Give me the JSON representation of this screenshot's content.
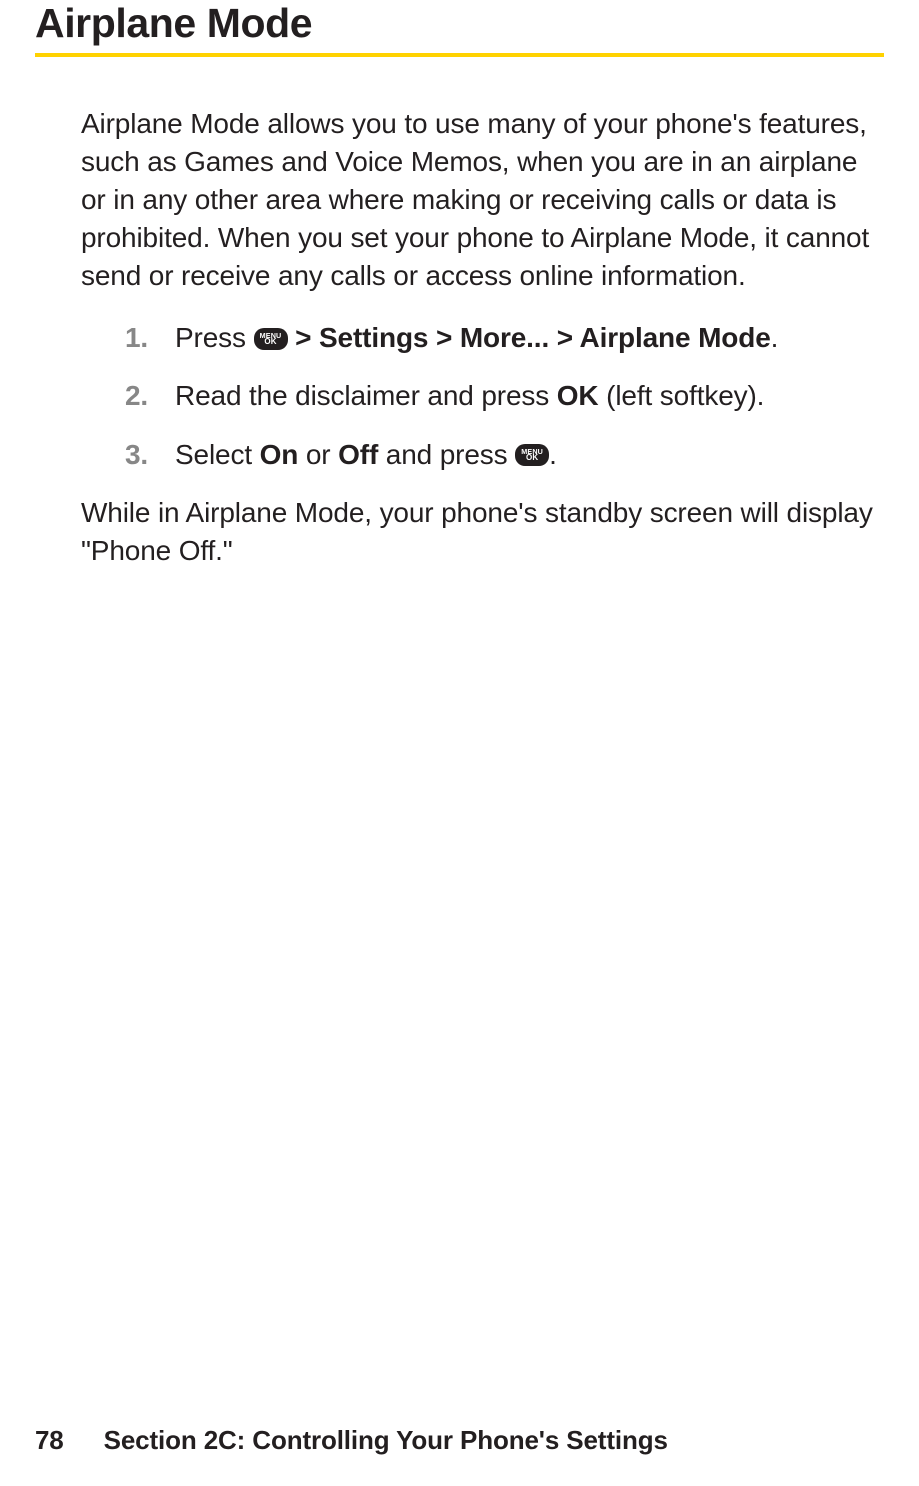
{
  "heading": "Airplane Mode",
  "intro": "Airplane Mode allows you to use many of your phone's features, such as Games and Voice Memos, when you are in an airplane or in any other area where making or receiving calls or data is prohibited. When you set your phone to Airplane Mode, it cannot send or receive any calls or access online information.",
  "steps": {
    "s1": {
      "num": "1.",
      "prefix": "Press ",
      "nav": " > Settings > More... > Airplane Mode",
      "suffix": "."
    },
    "s2": {
      "num": "2.",
      "t1": "Read the disclaimer and press ",
      "t2": "OK",
      "t3": " (left softkey)."
    },
    "s3": {
      "num": "3.",
      "t1": "Select ",
      "t2": "On",
      "t3": " or ",
      "t4": "Off",
      "t5": " and press ",
      "t6": "."
    }
  },
  "icon": {
    "line1": "MENU",
    "line2": "OK"
  },
  "outro": "While in Airplane Mode, your phone's standby screen will display \"Phone Off.\"",
  "footer": {
    "pagenum": "78",
    "section": "Section 2C: Controlling Your Phone's Settings"
  }
}
